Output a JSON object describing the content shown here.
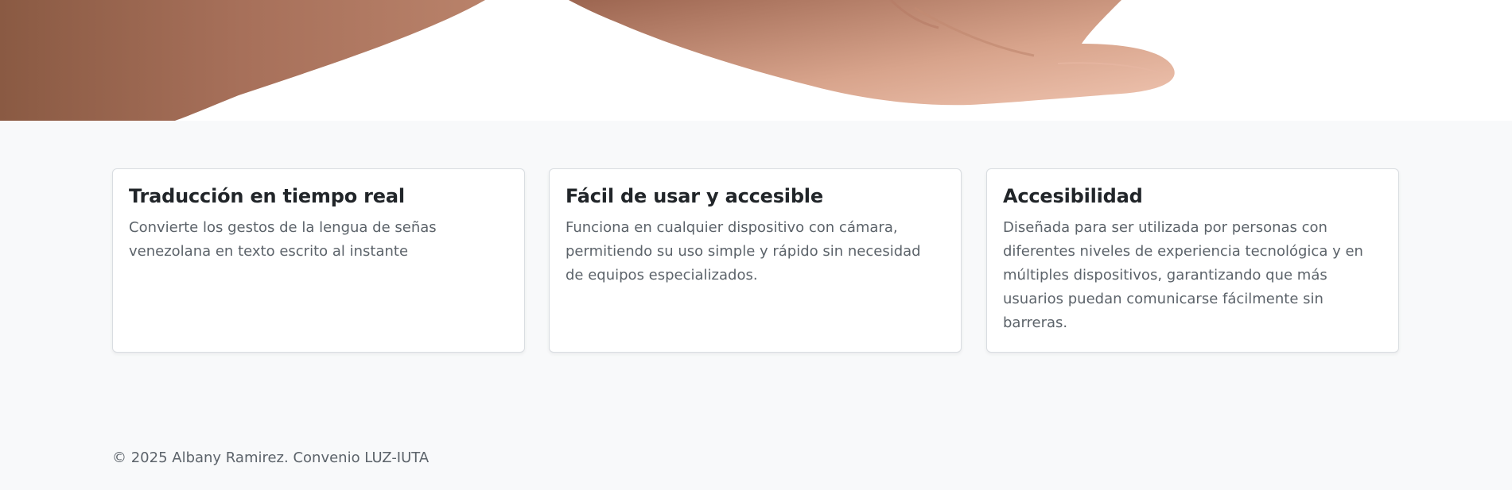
{
  "hero": {
    "image": "hands-photo",
    "skin_color": "#b97e61",
    "background_color": "#ffffff"
  },
  "features": [
    {
      "title": "Traducción en tiempo real",
      "text": "Convierte los gestos de la lengua de señas venezolana en texto escrito al instante"
    },
    {
      "title": "Fácil de usar y accesible",
      "text": "Funciona en cualquier dispositivo con cámara, permitiendo su uso simple y rápido sin necesidad de equipos especializados."
    },
    {
      "title": "Accesibilidad",
      "text": "Diseñada para ser utilizada por personas con diferentes niveles de experiencia tecnológica y en múltiples dispositivos, garantizando que más usuarios puedan comunicarse fácilmente sin barreras."
    }
  ],
  "footer": {
    "copyright": "© 2025 Albany Ramirez. Convenio LUZ-IUTA"
  }
}
